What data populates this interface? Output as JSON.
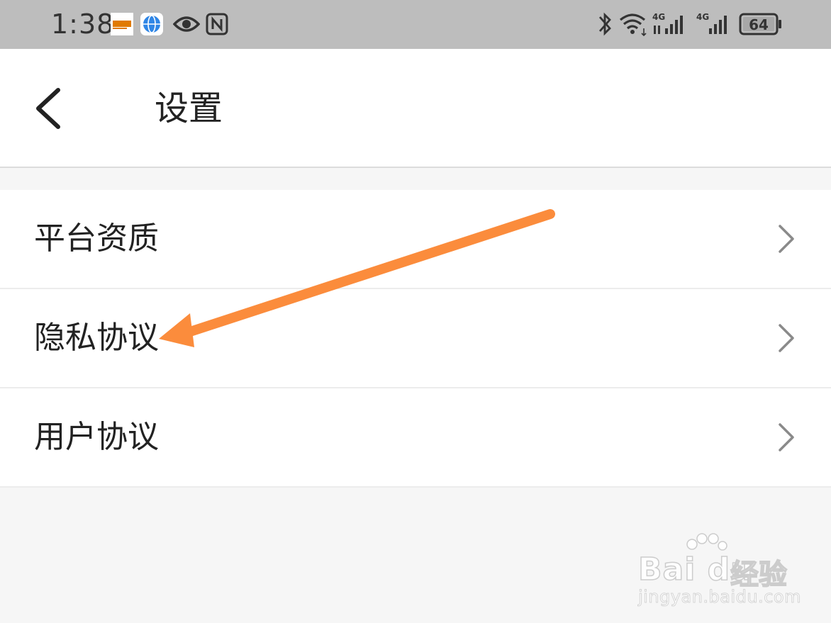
{
  "status_bar": {
    "time": "1:38",
    "battery": "64",
    "network_label_1": "4G",
    "network_label_2": "4G",
    "icons": [
      "news-app-icon",
      "browser-globe-icon",
      "eye-icon",
      "nfc-icon",
      "bluetooth-icon",
      "wifi-icon",
      "signal-icon",
      "battery-icon"
    ]
  },
  "header": {
    "title": "设置",
    "back_icon": "chevron-left-icon"
  },
  "settings": {
    "items": [
      {
        "label": "平台资质"
      },
      {
        "label": "隐私协议"
      },
      {
        "label": "用户协议"
      }
    ]
  },
  "annotation": {
    "color": "#fb8c3c"
  },
  "watermark": {
    "brand": "Bai du",
    "exp": "经验",
    "url": "jingyan.baidu.com"
  }
}
